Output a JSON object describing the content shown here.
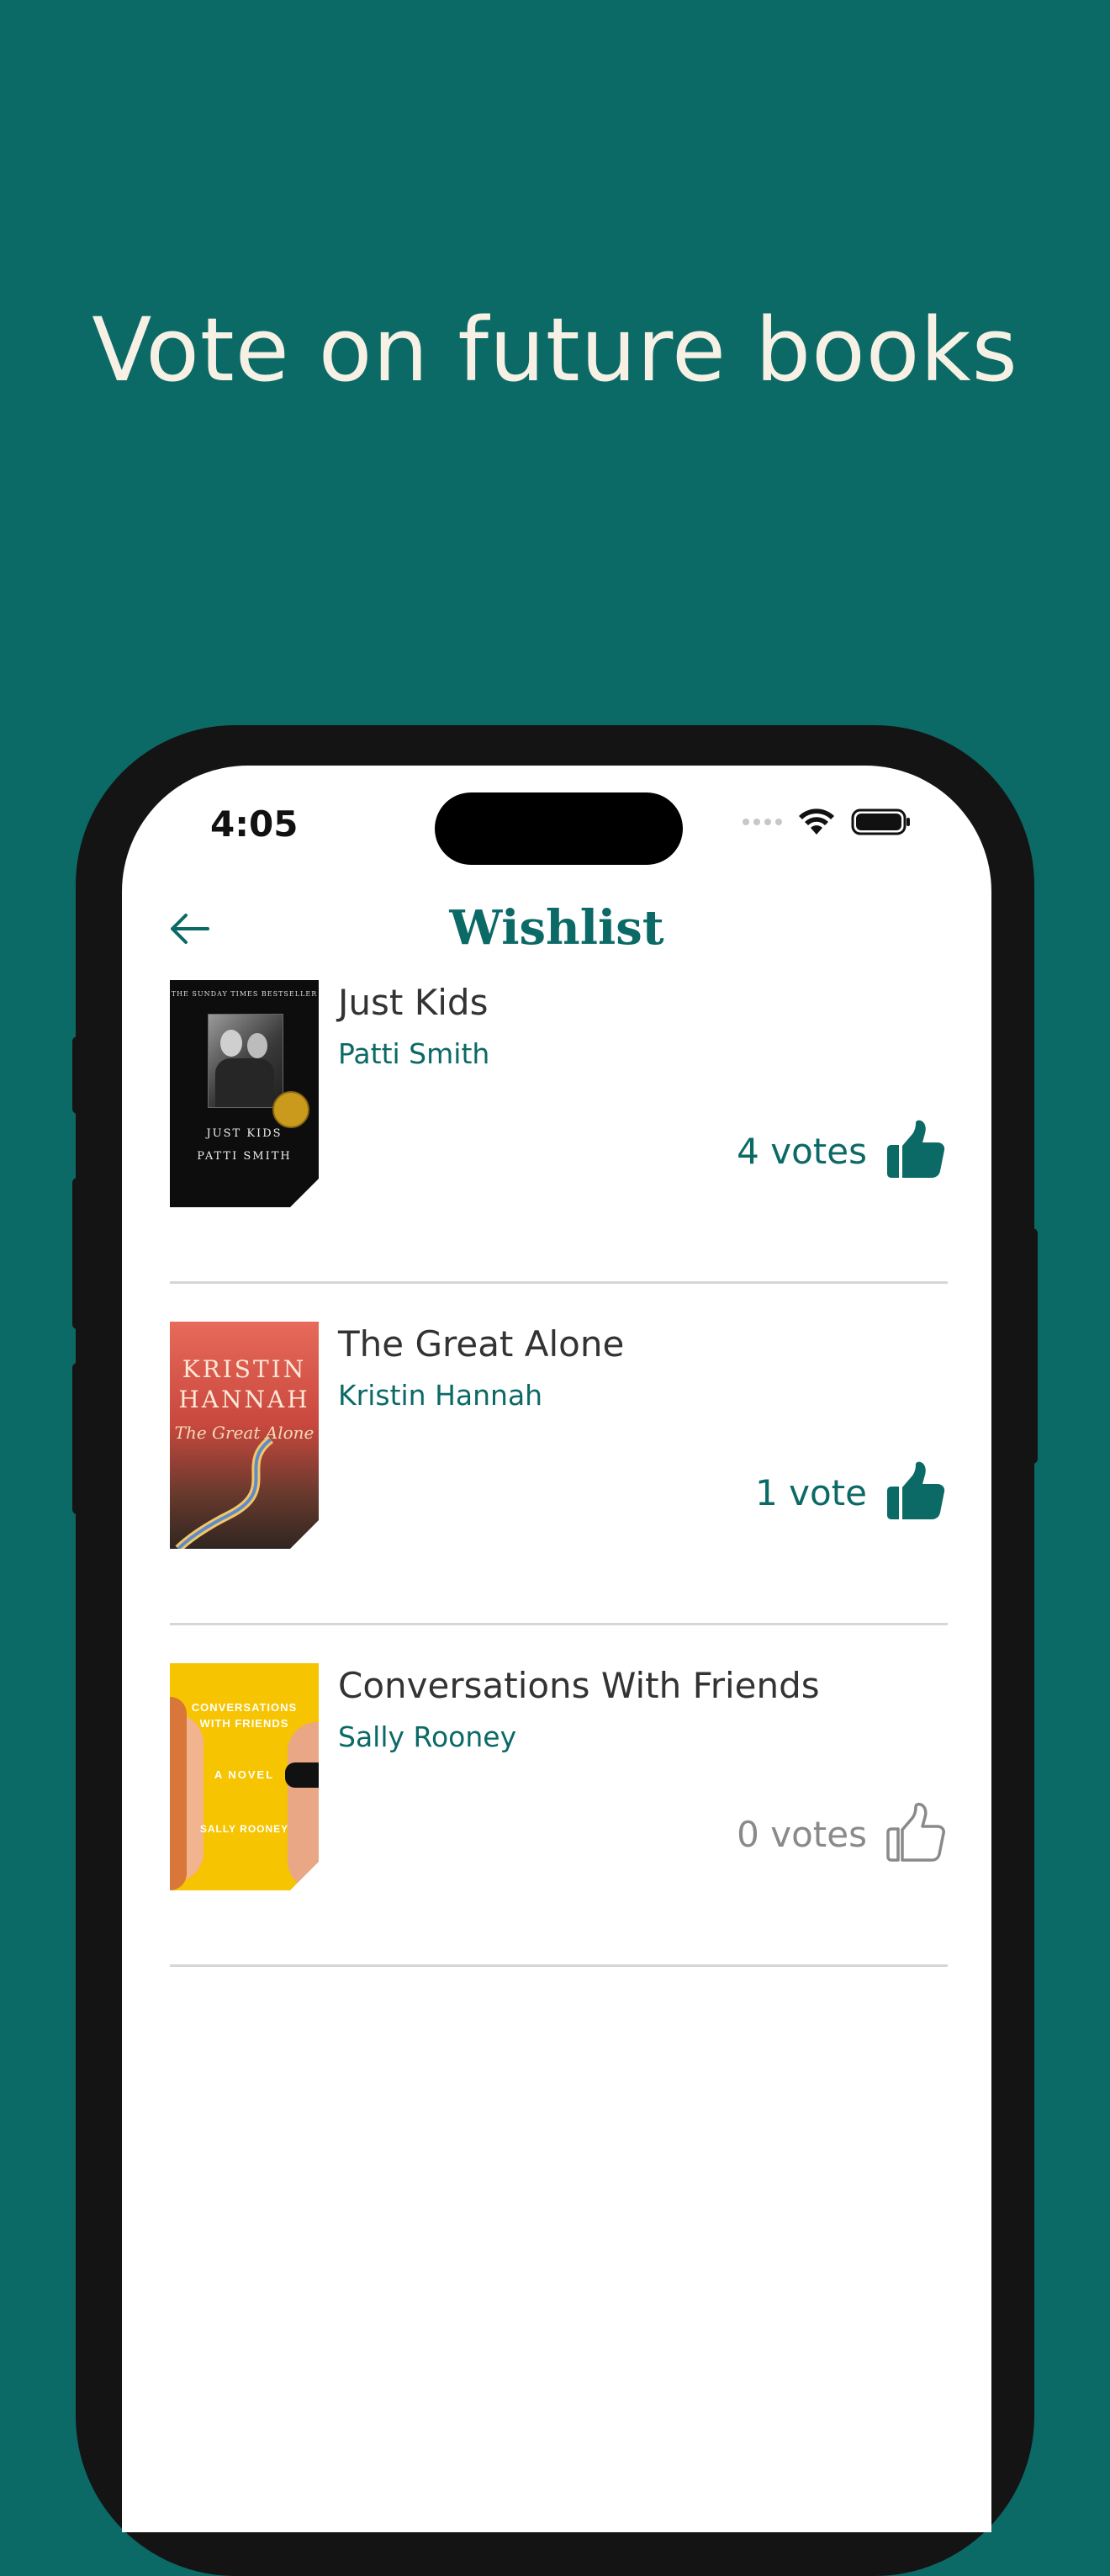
{
  "headline": "Vote on future books",
  "status_bar": {
    "time": "4:05"
  },
  "nav": {
    "title": "Wishlist"
  },
  "books": [
    {
      "title": "Just Kids",
      "author": "Patti Smith",
      "votes_label": "4 votes",
      "voted": true,
      "cover": {
        "top_text": "THE SUNDAY TIMES BESTSELLER",
        "line1": "JUST KIDS",
        "line2": "PATTI SMITH",
        "bg": "#0d0d0d"
      }
    },
    {
      "title": "The Great Alone",
      "author": "Kristin Hannah",
      "votes_label": "1 vote",
      "voted": true,
      "cover": {
        "line1": "KRISTIN",
        "line2": "HANNAH",
        "line3": "The Great Alone",
        "bg": "#c9483e"
      }
    },
    {
      "title": "Conversations With Friends",
      "author": "Sally Rooney",
      "votes_label": "0 votes",
      "voted": false,
      "cover": {
        "line1": "CONVERSATIONS",
        "line2": "WITH FRIENDS",
        "line3": "A NOVEL",
        "line4": "SALLY ROONEY",
        "bg": "#f6c400"
      }
    }
  ],
  "colors": {
    "brand": "#0b6966",
    "headline": "#f6f1e4",
    "inactive": "#8a8a8a"
  }
}
